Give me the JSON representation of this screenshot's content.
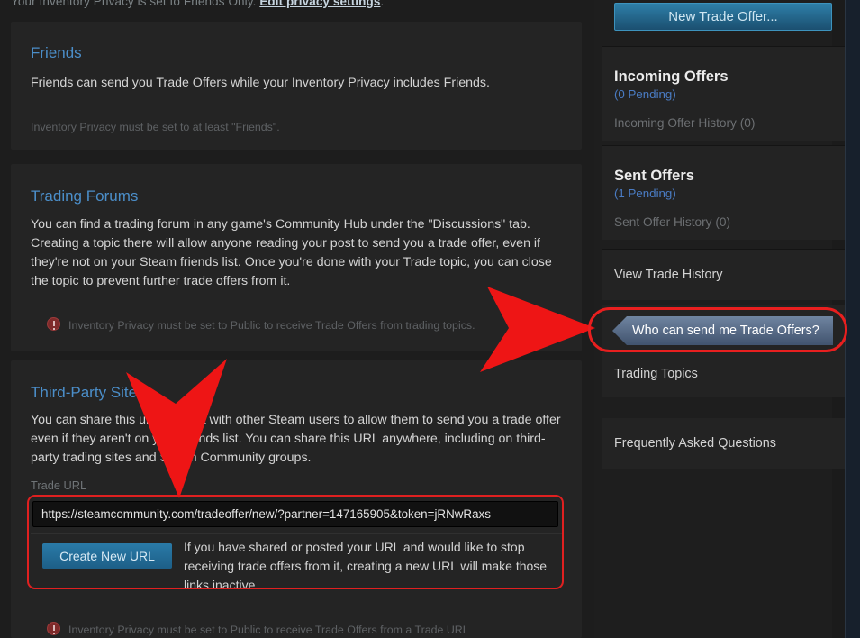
{
  "top_notice": {
    "text": "Your Inventory Privacy is set to Friends Only. ",
    "link": "Edit privacy settings",
    "period": "."
  },
  "panels": [
    {
      "title": "Friends",
      "body": "Friends can send you Trade Offers while your Inventory Privacy includes Friends.",
      "note": "Inventory Privacy must be set to at least \"Friends\"."
    },
    {
      "title": "Trading Forums",
      "body": "You can find a trading forum in any game's Community Hub under the \"Discussions\" tab. Creating a topic there will allow anyone reading your post to send you a trade offer, even if they're not on your Steam friends list. Once you're done with your Trade topic, you can close the topic to prevent further trade offers from it.",
      "note": "Inventory Privacy must be set to Public to receive Trade Offers from trading topics."
    },
    {
      "title": "Third-Party Sites",
      "body": "You can share this unique URL with other Steam users to allow them to send you a trade offer even if they aren't on your friends list. You can share this URL anywhere, including on third-party trading sites and Steam Community groups.",
      "field_label": "Trade URL",
      "url_value": "https://steamcommunity.com/tradeoffer/new/?partner=147165905&token=jRNwRaxs",
      "create_button": "Create New URL",
      "create_desc": "If you have shared or posted your URL and would like to stop receiving trade offers from it, creating a new URL will make those links inactive.",
      "note": "Inventory Privacy must be set to Public to receive Trade Offers from a Trade URL"
    }
  ],
  "sidebar": {
    "new_offer_button": "New Trade Offer...",
    "incoming": {
      "heading": "Incoming Offers",
      "pending": "(0 Pending)",
      "history": "Incoming Offer History (0)"
    },
    "sent": {
      "heading": "Sent Offers",
      "pending": "(1 Pending)",
      "history": "Sent Offer History (0)"
    },
    "view_trade_history": "View Trade History",
    "who_can_send": "Who can send me Trade Offers?",
    "trading_topics": "Trading Topics",
    "faq": "Frequently Asked Questions"
  },
  "colors": {
    "accent_blue": "#4b8ec9",
    "annotation_red": "#e81f1f",
    "button_blue": "#2e7fa8",
    "active_tab": "#6f84a0"
  }
}
